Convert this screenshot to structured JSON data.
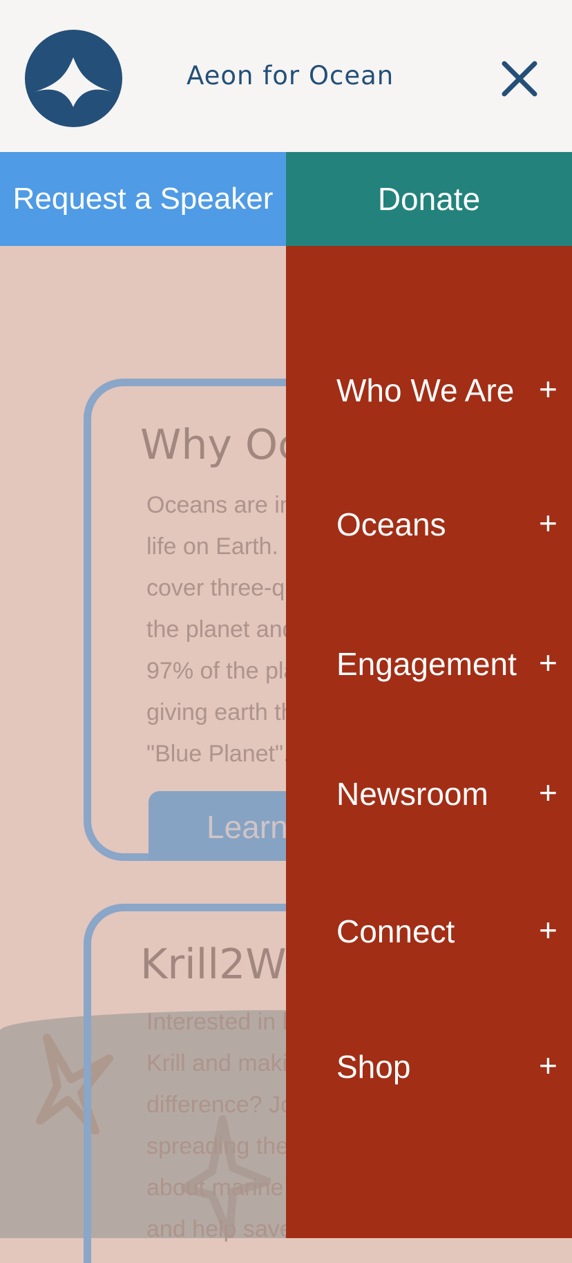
{
  "header": {
    "title": "Aeon for Ocean",
    "logo_icon": "whale-tail-logo",
    "close_icon": "close-icon"
  },
  "actions": {
    "speaker_label": "Request a Speaker",
    "donate_label": "Donate"
  },
  "drawer": {
    "items": [
      {
        "label": "Who We Are",
        "expand": "+"
      },
      {
        "label": "Oceans",
        "expand": "+"
      },
      {
        "label": "Engagement",
        "expand": "+"
      },
      {
        "label": "Newsroom",
        "expand": "+"
      },
      {
        "label": "Connect",
        "expand": "+"
      },
      {
        "label": "Shop",
        "expand": "+"
      }
    ]
  },
  "background": {
    "card1": {
      "title": "Why Oc",
      "lines": [
        "Oceans are in",
        "life on Earth.",
        "cover three-qu",
        "the planet and",
        "97% of the pla",
        "giving earth th",
        "\"Blue Planet\"."
      ],
      "button": "Learn"
    },
    "card2": {
      "title": "Krill2W",
      "lines": [
        "Interested in k",
        "Krill and maki",
        "difference? Jo",
        "spreading the",
        "about marine",
        "and help save"
      ]
    }
  },
  "colors": {
    "header_bg": "#f6f5f3",
    "brand_blue": "#244f78",
    "speaker_bg": "#4f9be5",
    "donate_bg": "#23837c",
    "drawer_bg": "#a22e16"
  }
}
